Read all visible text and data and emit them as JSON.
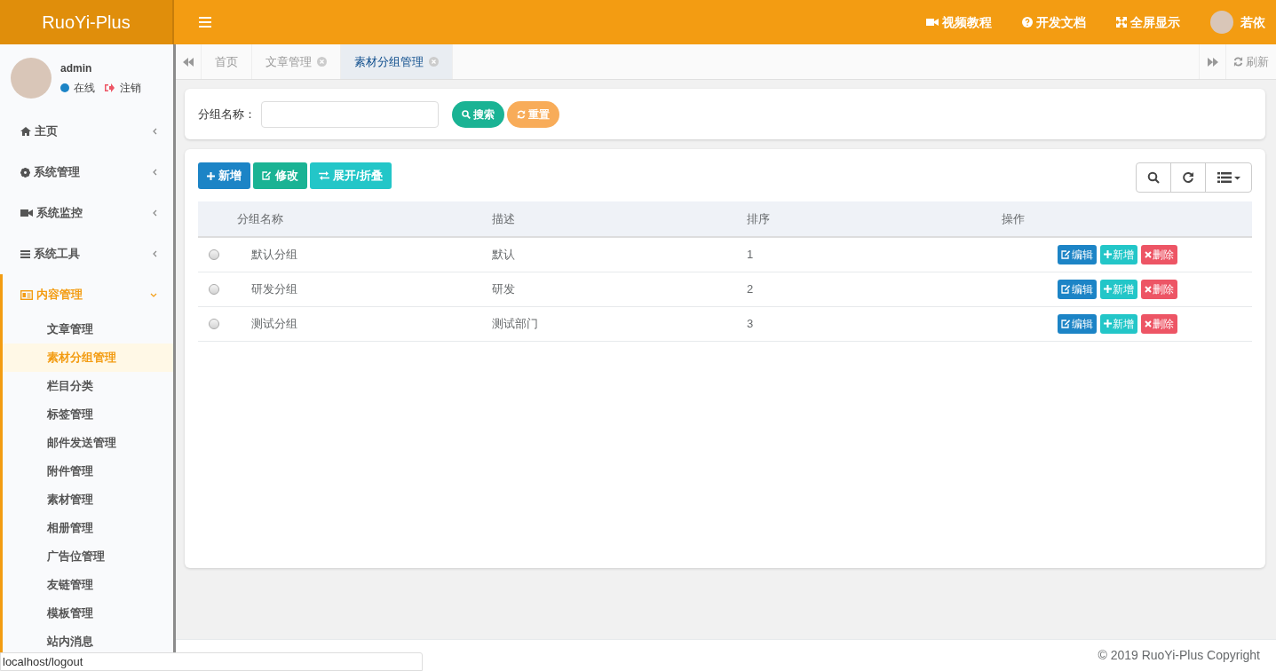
{
  "brand": "RuoYi-Plus",
  "header_links": [
    {
      "kind": "video",
      "label": "视频教程"
    },
    {
      "kind": "help",
      "label": "开发文档"
    },
    {
      "kind": "fullscreen",
      "label": "全屏显示"
    }
  ],
  "header_user": {
    "name": "若依"
  },
  "user_panel": {
    "name": "admin",
    "status": "在线",
    "logout": "注销"
  },
  "sidebar": {
    "items": [
      {
        "kind": "home",
        "label": "主页",
        "expanded": false
      },
      {
        "kind": "gear",
        "label": "系统管理",
        "expanded": false
      },
      {
        "kind": "video",
        "label": "系统监控",
        "expanded": false
      },
      {
        "kind": "bars",
        "label": "系统工具",
        "expanded": false
      },
      {
        "kind": "card",
        "label": "内容管理",
        "expanded": true,
        "children": [
          {
            "label": "文章管理",
            "selected": false
          },
          {
            "label": "素材分组管理",
            "selected": true
          },
          {
            "label": "栏目分类",
            "selected": false
          },
          {
            "label": "标签管理",
            "selected": false
          },
          {
            "label": "邮件发送管理",
            "selected": false
          },
          {
            "label": "附件管理",
            "selected": false
          },
          {
            "label": "素材管理",
            "selected": false
          },
          {
            "label": "相册管理",
            "selected": false
          },
          {
            "label": "广告位管理",
            "selected": false
          },
          {
            "label": "友链管理",
            "selected": false
          },
          {
            "label": "模板管理",
            "selected": false
          },
          {
            "label": "站内消息",
            "selected": false
          }
        ]
      }
    ]
  },
  "tabs": [
    {
      "label": "首页",
      "selected": false,
      "closable": false
    },
    {
      "label": "文章管理",
      "selected": false,
      "closable": true
    },
    {
      "label": "素材分组管理",
      "selected": true,
      "closable": true
    }
  ],
  "refresh": "刷新",
  "search": {
    "label": "分组名称：",
    "buttons": [
      {
        "kind": "search",
        "label": "搜索"
      },
      {
        "kind": "reset",
        "label": "重置"
      }
    ]
  },
  "toolbar": [
    {
      "kind": "add",
      "label": "新增"
    },
    {
      "kind": "edit",
      "label": "修改"
    },
    {
      "kind": "toggle",
      "label": "展开/折叠"
    }
  ],
  "table": {
    "columns": [
      "分组名称",
      "描述",
      "排序",
      "操作"
    ],
    "rows": [
      {
        "selected": false,
        "cells": [
          "默认分组",
          "默认",
          "1"
        ],
        "actions": [
          {
            "kind": "edit",
            "label": "编辑"
          },
          {
            "kind": "add",
            "label": "新增"
          },
          {
            "kind": "delete",
            "label": "删除"
          }
        ]
      },
      {
        "selected": false,
        "cells": [
          "研发分组",
          "研发",
          "2"
        ],
        "actions": [
          {
            "kind": "edit",
            "label": "编辑"
          },
          {
            "kind": "add",
            "label": "新增"
          },
          {
            "kind": "delete",
            "label": "删除"
          }
        ]
      },
      {
        "selected": false,
        "cells": [
          "测试分组",
          "测试部门",
          "3"
        ],
        "actions": [
          {
            "kind": "edit",
            "label": "编辑"
          },
          {
            "kind": "add",
            "label": "新增"
          },
          {
            "kind": "delete",
            "label": "删除"
          }
        ]
      }
    ]
  },
  "footer": "© 2019 RuoYi-Plus Copyright",
  "status_bar": "localhost/logout"
}
